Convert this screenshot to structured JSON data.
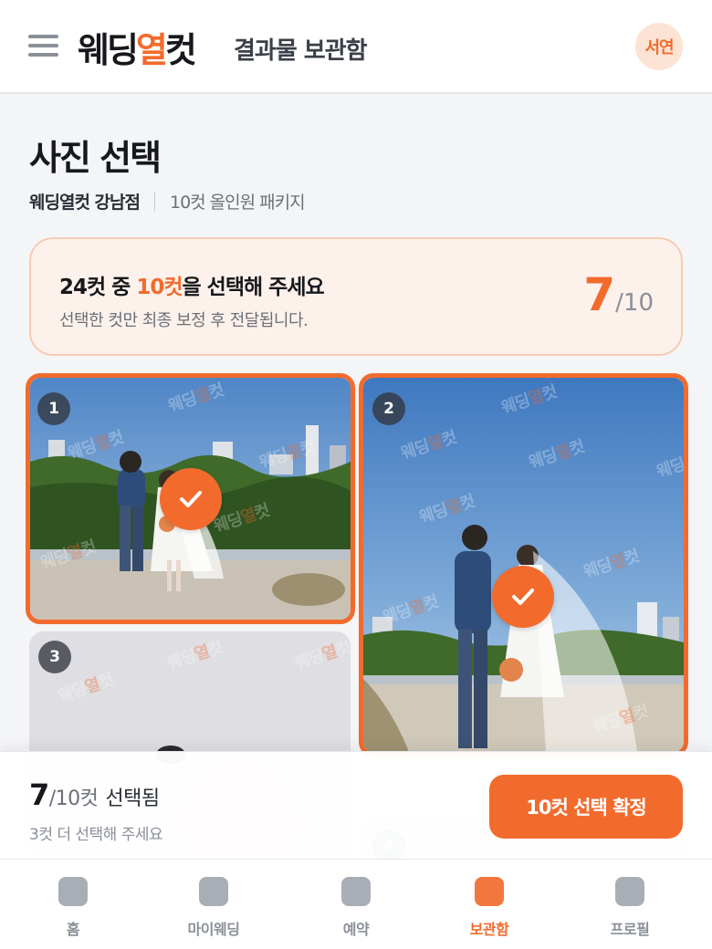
{
  "header": {
    "logo_part1": "웨딩",
    "logo_part2": "열",
    "logo_part3": "컷",
    "title": "결과물 보관함",
    "avatar_text": "서연",
    "menu_icon": "hamburger-icon"
  },
  "page": {
    "title": "사진 선택",
    "studio": "웨딩열컷 강남점",
    "package": "10컷 올인원 패키지"
  },
  "info_card": {
    "main_pre": "24컷 중 ",
    "main_highlight": "10컷",
    "main_post": "을 선택해 주세요",
    "sub": "선택한 컷만 최종 보정 후 전달됩니다.",
    "selected": "7",
    "total": "/10"
  },
  "photos": [
    {
      "number": "1",
      "selected": true
    },
    {
      "number": "2",
      "selected": true
    },
    {
      "number": "3",
      "selected": false
    },
    {
      "number": "4",
      "selected": false
    }
  ],
  "watermark": {
    "part1": "웨딩",
    "part2": "열",
    "part3": "컷"
  },
  "action_bar": {
    "count": "7",
    "of_total": "/10컷",
    "selected_label": "선택됨",
    "hint": "3컷 더 선택해 주세요",
    "confirm_label": "10컷 선택 확정"
  },
  "tabs": [
    {
      "label": "홈",
      "active": false
    },
    {
      "label": "마이웨딩",
      "active": false
    },
    {
      "label": "예약",
      "active": false
    },
    {
      "label": "보관함",
      "active": true
    },
    {
      "label": "프로필",
      "active": false
    }
  ],
  "colors": {
    "accent": "#f26b2d",
    "card_bg": "#fdf1eb",
    "inactive_icon": "#a8adb6"
  }
}
